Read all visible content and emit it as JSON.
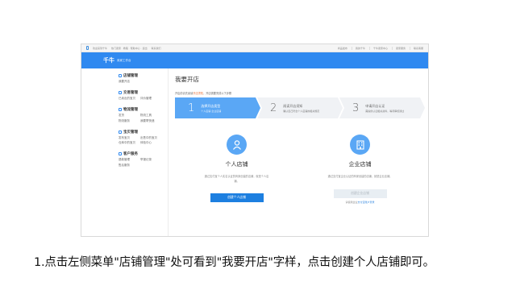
{
  "topbar": {
    "left_items": [
      "欢迎来到千牛",
      "热门卖家 · 教程 · 帮助中心 · 退出",
      "联系我们"
    ],
    "right_items": [
      "商品发布",
      "我的千牛",
      "千牛卖家中心",
      "卖家服务",
      "联系客服"
    ]
  },
  "brand": {
    "logo": "千牛",
    "subtitle": "卖家工作台"
  },
  "sidebar": {
    "sections": [
      {
        "title": "店铺管理",
        "items": [
          "我要开店"
        ]
      },
      {
        "title": "交易管理",
        "items": [
          "已卖出的宝贝",
          "评价管理"
        ]
      },
      {
        "title": "物流管理",
        "items": [
          "发货",
          "物流工具",
          "物流服务",
          "我要寄快递"
        ]
      },
      {
        "title": "宝贝管理",
        "items": [
          "发布宝贝",
          "出售中的宝贝",
          "仓库中的宝贝",
          "体检中心"
        ]
      },
      {
        "title": "客户服务",
        "items": [
          "退款管理",
          "举报记录",
          "售后服务"
        ]
      }
    ]
  },
  "main": {
    "title": "我要开店",
    "notice_prefix": "开店前请先阅读",
    "notice_link": "开店须知",
    "notice_suffix": "，开店需要完成以下步骤",
    "steps": [
      {
        "num": "1",
        "title": "选择开店类型",
        "sub": "个人店铺 企业店铺"
      },
      {
        "num": "2",
        "title": "阅读开店须知",
        "sub": "确认自己符合个人店铺的相关规定"
      },
      {
        "num": "3",
        "title": "申请开店认证",
        "sub": "需提供认证相关资料，等待审核通过"
      }
    ],
    "shops": [
      {
        "name": "个人店铺",
        "desc": "通过支付宝个人实名认证的商家创建的店铺，就是个人店铺。",
        "button": "创建个人店铺",
        "note_prefix": "",
        "note_link": ""
      },
      {
        "name": "企业店铺",
        "desc": "通过支付宝企业认证的商家创建的店铺，就是企业店铺。",
        "button": "创建企业店铺",
        "note_prefix": "请使用企业",
        "note_link": "支付宝账户登录"
      }
    ]
  },
  "caption": "1.点击左侧菜单\"店铺管理\"处可看到\"我要开店\"字样，点击创建个人店铺即可。",
  "colors": {
    "brand": "#2f89f0",
    "step_active": "#5aa7f5",
    "button": "#1d7fe0"
  }
}
